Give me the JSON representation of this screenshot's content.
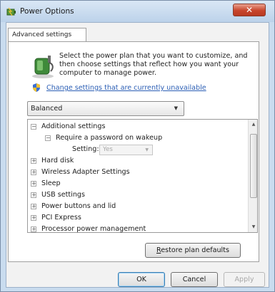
{
  "window": {
    "title": "Power Options",
    "close_glyph": "✕"
  },
  "tab": {
    "label": "Advanced settings"
  },
  "intro": {
    "line1": "Select the power plan that you want to customize, and",
    "line2": "then choose settings that reflect how you want your",
    "line3": "computer to manage power.",
    "link": "Change settings that are currently unavailable"
  },
  "plan_select": {
    "value": "Balanced"
  },
  "tree": {
    "additional_settings": "Additional settings",
    "require_password": "Require a password on wakeup",
    "setting_label": "Setting:",
    "setting_value": "Yes",
    "items": [
      "Hard disk",
      "Wireless Adapter Settings",
      "Sleep",
      "USB settings",
      "Power buttons and lid",
      "PCI Express",
      "Processor power management"
    ],
    "expand_glyph": "+",
    "collapse_glyph": "−"
  },
  "buttons": {
    "restore_defaults": "Restore plan defaults",
    "restore_access_key": "R",
    "ok": "OK",
    "cancel": "Cancel",
    "apply": "Apply"
  },
  "icons": {
    "window_icon": "power-options-icon",
    "plan_icon": "battery-plug-icon",
    "shield_icon": "uac-shield-icon"
  },
  "colors": {
    "link": "#2c5fb5",
    "title_bar": "#bcd2ea",
    "close_button": "#c8452c"
  }
}
